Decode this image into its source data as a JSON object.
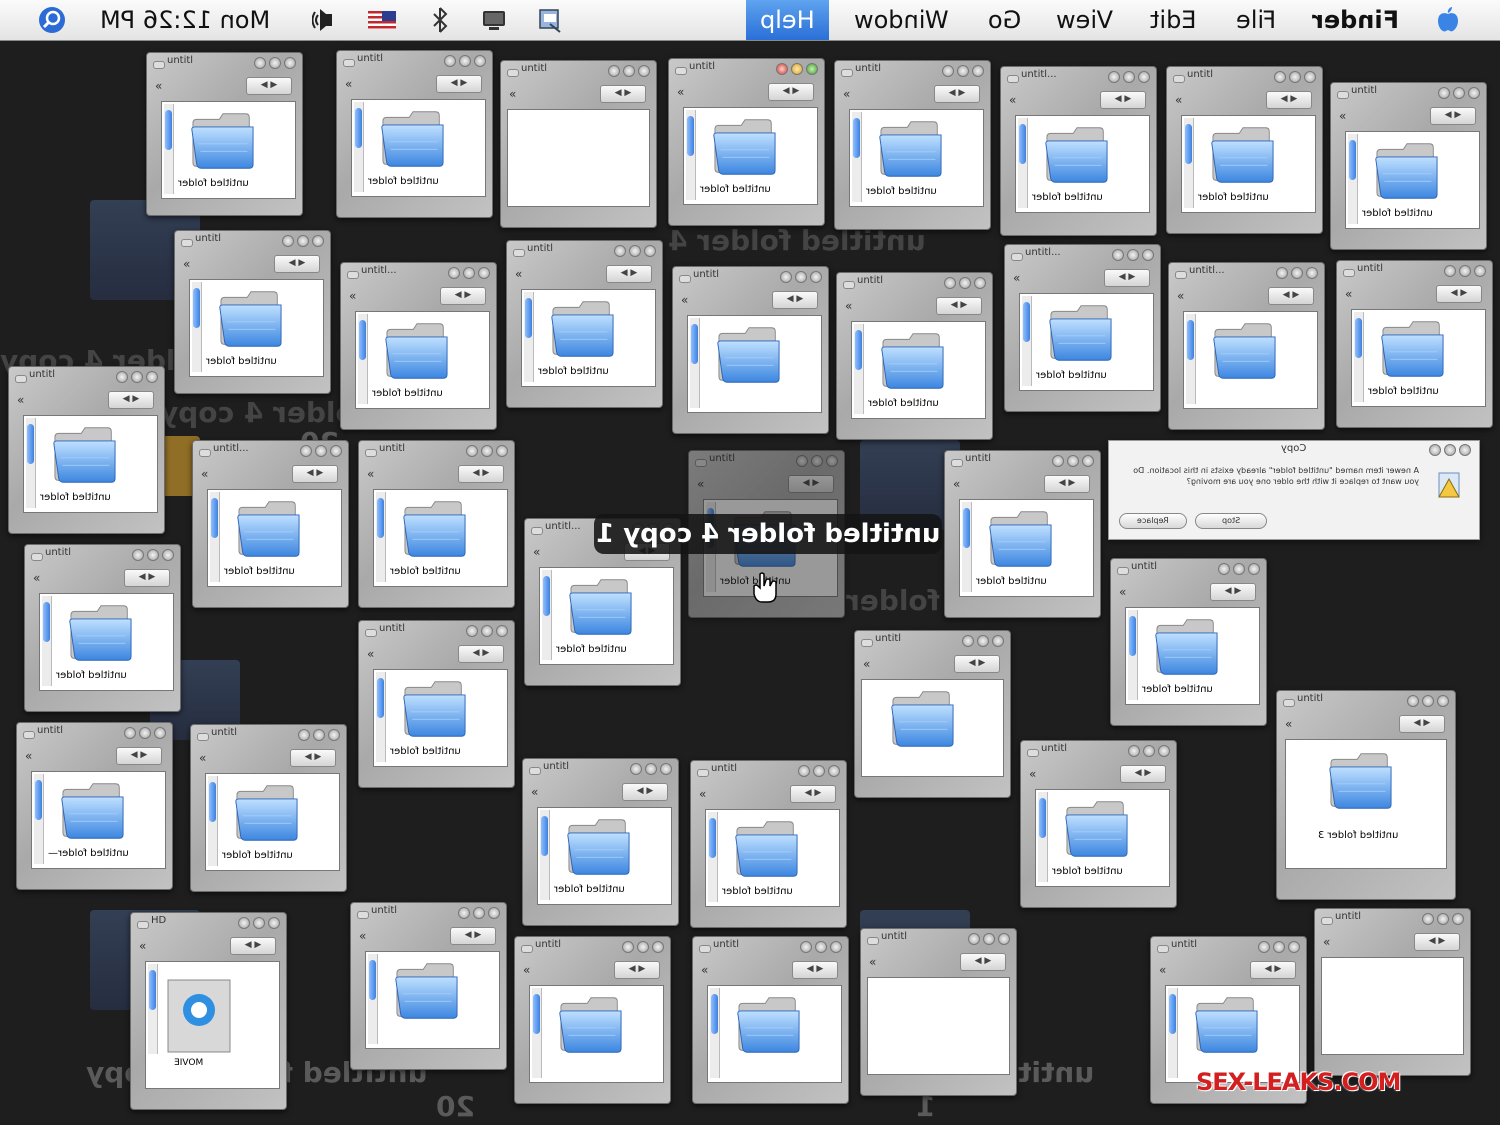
{
  "menubar": {
    "apple": "",
    "finder": "Finder",
    "file": "File",
    "edit": "Edit",
    "view": "View",
    "go": "Go",
    "window": "Window",
    "help": "Help",
    "clock": "Mon 12:26 PM"
  },
  "window_label": "untitl",
  "window_label_alt": "untitl...",
  "folder_name": "untitled folder",
  "folder_name_3": "untitled folder 3",
  "folder_name_dash": "untitled folder—",
  "movie_label": "MOVIE",
  "hd_label": "HD",
  "dialog": {
    "title": "Copy",
    "message": "A newer item named \"untitled folder\" already exists in this location. Do you want to replace it with the older one you are moving?",
    "stop": "Stop",
    "replace": "Replace"
  },
  "drag_label": "untitled folder 4 copy 1",
  "ghost_labels": {
    "top": "untitled folder 4",
    "left1": "folder 4 copy",
    "left2": "folder 4 copy",
    "left2_num": "20",
    "mid_right": "d folder",
    "bottom_row": "untitled folder 4 copy",
    "bottom_num": "20",
    "bottom_right": "untit",
    "bottom_right_num": "1"
  },
  "watermark": "SEX-LEAKS.COM",
  "colors": {
    "background": "#1e1e1f",
    "highlight": "#2a6fd6",
    "watermark": "#d31f1f"
  }
}
